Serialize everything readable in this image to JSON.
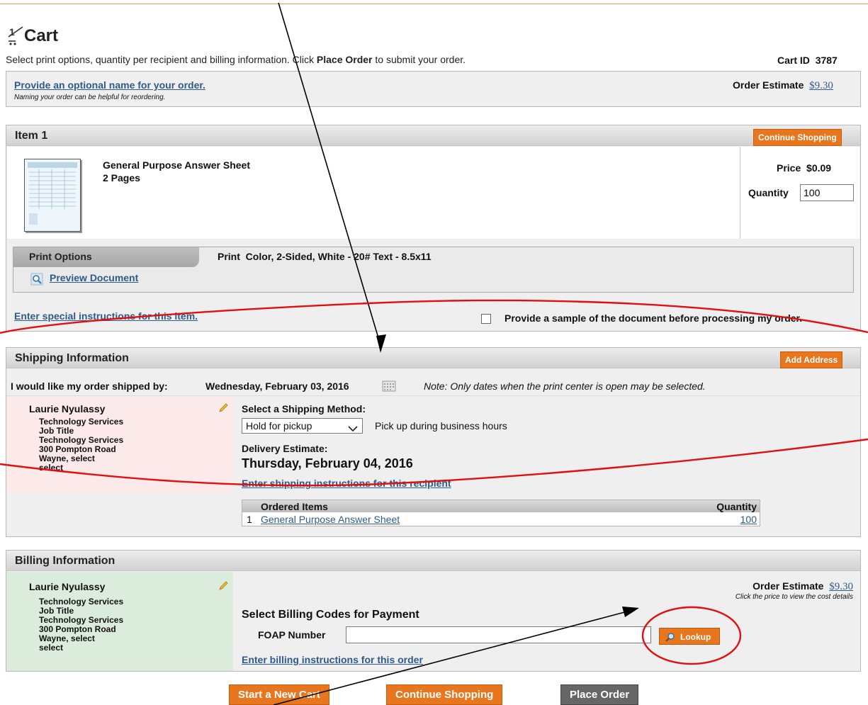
{
  "page": {
    "title": "Cart",
    "subtitle_before": "Select print options, quantity per recipient and billing information. Click ",
    "subtitle_bold": "Place Order",
    "subtitle_after": " to submit your order.",
    "cart_id_label": "Cart ID",
    "cart_id_value": "3787"
  },
  "order_name": {
    "link": "Provide an optional name for your order.",
    "hint": "Naming your order can be helpful for reordering.",
    "estimate_label": "Order Estimate",
    "estimate_value": "$9.30"
  },
  "item": {
    "header": "Item 1",
    "continue_button": "Continue Shopping",
    "name": "General Purpose Answer Sheet",
    "pages": "2 Pages",
    "price_label": "Price",
    "price_value": "$0.09",
    "quantity_label": "Quantity",
    "quantity_value": "100",
    "print_options_label": "Print Options",
    "print_label": "Print",
    "print_value": "Color, 2-Sided, White - 20# Text - 8.5x11",
    "preview_link": "Preview Document",
    "special_instructions_link": "Enter special instructions for this item.",
    "sample_label": "Provide a sample of the document before processing my order."
  },
  "shipping": {
    "header": "Shipping Information",
    "add_address_button": "Add Address",
    "ship_by_label": "I would like my order shipped by:",
    "ship_by_date": "Wednesday, February 03, 2016",
    "note": "Note: Only dates when the print center is open may be selected.",
    "recipient": {
      "name": "Laurie Nyulassy",
      "lines": [
        "Technology Services",
        "Job Title",
        "Technology Services",
        "300 Pompton Road",
        "Wayne, select",
        "select"
      ]
    },
    "method_label": "Select a Shipping Method:",
    "method_value": "Hold for pickup",
    "method_note": "Pick up during business hours",
    "delivery_label": "Delivery Estimate:",
    "delivery_date": "Thursday, February 04, 2016",
    "instructions_link": "Enter shipping instructions for this recipient",
    "ordered_items_header": "Ordered Items",
    "quantity_header": "Quantity",
    "row_index": "1",
    "row_item": "General Purpose Answer Sheet",
    "row_qty": "100"
  },
  "billing": {
    "header": "Billing Information",
    "recipient": {
      "name": "Laurie Nyulassy",
      "lines": [
        "Technology Services",
        "Job Title",
        "Technology Services",
        "300 Pompton Road",
        "Wayne, select",
        "select"
      ]
    },
    "estimate_label": "Order Estimate",
    "estimate_value": "$9.30",
    "estimate_hint": "Click the price to view the cost details",
    "codes_title": "Select Billing Codes for Payment",
    "foap_label": "FOAP Number",
    "foap_value": "",
    "lookup_button": "Lookup",
    "instructions_link": "Enter billing instructions for this order"
  },
  "footer": {
    "new_cart": "Start a New Cart",
    "continue": "Continue Shopping",
    "place_order": "Place Order"
  },
  "colors": {
    "accent_orange": "#e8761e",
    "annotation_red": "#e01010",
    "shipping_recipient_bg": "#fce9e9",
    "billing_recipient_bg": "#dcecdc",
    "link": "#2f5a8a"
  },
  "icons": [
    "cart-icon",
    "magnifier-icon",
    "calendar-icon",
    "pencil-icon",
    "dropdown-chevron-icon"
  ]
}
